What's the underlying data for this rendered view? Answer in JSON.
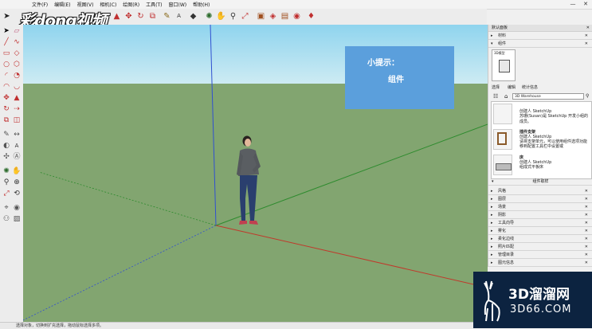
{
  "menu": {
    "items": [
      "文件(F)",
      "编辑(E)",
      "视图(V)",
      "相机(C)",
      "绘图(R)",
      "工具(T)",
      "窗口(W)",
      "帮助(H)"
    ]
  },
  "window_controls": {
    "minimize": "—",
    "close": "✕"
  },
  "logo": {
    "text": "彩dong视频"
  },
  "tip": {
    "title": "小提示：",
    "body": "组件"
  },
  "panel": {
    "title": "默认面板",
    "sections_top": [
      {
        "arrow": "▸",
        "label": "材料"
      },
      {
        "arrow": "▾",
        "label": "组件"
      }
    ],
    "preview_label": "3D模型",
    "tabs": [
      "选择",
      "编辑",
      "统计信息"
    ],
    "search": {
      "value": "3D Warehouse"
    },
    "components": [
      {
        "title": "",
        "lines": [
          "创建人 SketchUp",
          "苏珊(Susan)是 SketchUp 开发小组的成员。",
          ""
        ]
      },
      {
        "title": "插件支架",
        "lines": [
          "创建人 SketchUp",
          "请将支架单元，可以使用组件选项功能",
          "移到配置工具栏中设置或"
        ]
      },
      {
        "title": "床",
        "lines": [
          "创建人 SketchUp",
          "组成式平板床",
          ""
        ]
      }
    ],
    "footer_label": "组件取样",
    "sections": [
      {
        "arrow": "▸",
        "label": "风格"
      },
      {
        "arrow": "▸",
        "label": "图层"
      },
      {
        "arrow": "▸",
        "label": "场景"
      },
      {
        "arrow": "▸",
        "label": "阴影"
      },
      {
        "arrow": "▸",
        "label": "工具向导"
      },
      {
        "arrow": "▸",
        "label": "雾化"
      },
      {
        "arrow": "▸",
        "label": "柔化边线"
      },
      {
        "arrow": "▸",
        "label": "照片匹配"
      },
      {
        "arrow": "▸",
        "label": "管理目录"
      },
      {
        "arrow": "▸",
        "label": "图元信息"
      }
    ]
  },
  "status": {
    "text": "选择对象，切换到扩充选择，拖动鼠标选择多项。"
  },
  "watermark": {
    "big": "3D溜溜网",
    "small": "3D66.COM"
  },
  "colors": {
    "sky_top": "#8fd4ee",
    "ground": "#82a570",
    "axis_red": "#c0392b",
    "axis_green": "#2e8b2e",
    "axis_blue": "#3050d0",
    "tip_bg": "#5b9fdc",
    "watermark_bg": "#0c2340"
  }
}
